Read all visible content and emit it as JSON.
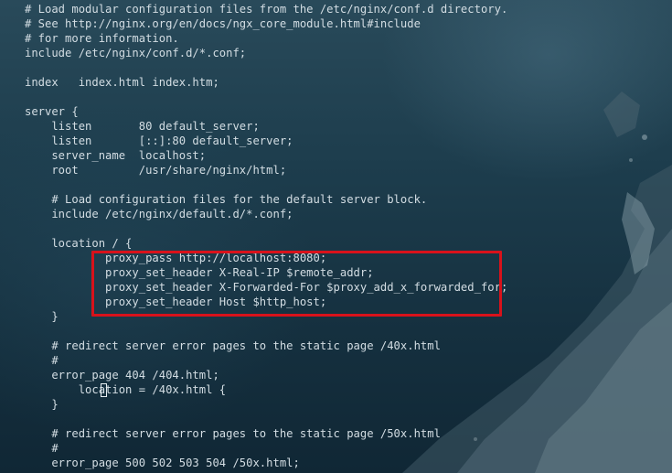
{
  "editor": {
    "lines": [
      "# Load modular configuration files from the /etc/nginx/conf.d directory.",
      "# See http://nginx.org/en/docs/ngx_core_module.html#include",
      "# for more information.",
      "include /etc/nginx/conf.d/*.conf;",
      "",
      "index   index.html index.htm;",
      "",
      "server {",
      "    listen       80 default_server;",
      "    listen       [::]:80 default_server;",
      "    server_name  localhost;",
      "    root         /usr/share/nginx/html;",
      "",
      "    # Load configuration files for the default server block.",
      "    include /etc/nginx/default.d/*.conf;",
      "",
      "    location / {",
      "            proxy_pass http://localhost:8080;",
      "            proxy_set_header X-Real-IP $remote_addr;",
      "            proxy_set_header X-Forwarded-For $proxy_add_x_forwarded_for;",
      "            proxy_set_header Host $http_host;",
      "    }",
      "",
      "    # redirect server error pages to the static page /40x.html",
      "    #",
      "    error_page 404 /404.html;",
      "        location = /40x.html {",
      "    }",
      "",
      "    # redirect server error pages to the static page /50x.html",
      "    #",
      "    error_page 500 502 503 504 /50x.html;"
    ],
    "highlight_color": "#d8121b",
    "text_color": "#d3dde3",
    "cursor": {
      "line": 27,
      "column": 12
    }
  }
}
